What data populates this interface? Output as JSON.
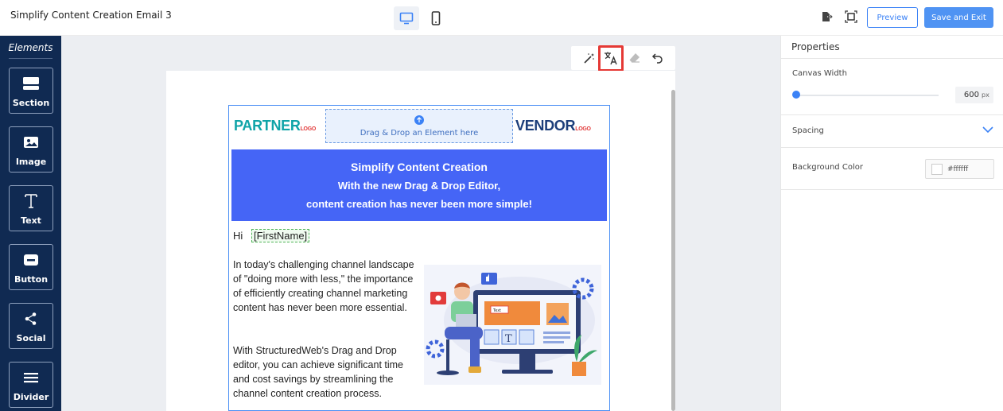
{
  "header": {
    "title": "Simplify Content Creation Email 3",
    "preview_label": "Preview",
    "save_label": "Save and Exit",
    "icons": [
      "desktop-icon",
      "mobile-icon",
      "export-icon",
      "fullscreen-icon"
    ]
  },
  "sidebar": {
    "heading": "Elements",
    "items": [
      {
        "label": "Section",
        "icon": "section-icon"
      },
      {
        "label": "Image",
        "icon": "image-icon"
      },
      {
        "label": "Text",
        "icon": "text-icon"
      },
      {
        "label": "Button",
        "icon": "button-icon"
      },
      {
        "label": "Social",
        "icon": "share-icon"
      },
      {
        "label": "Divider",
        "icon": "divider-icon"
      }
    ]
  },
  "edit_toolbar": {
    "icons": [
      "magic-wand-icon",
      "translate-icon",
      "eraser-icon",
      "undo-icon"
    ],
    "highlighted": "translate-icon",
    "highlight_color": "#e53935"
  },
  "email": {
    "partner_logo": {
      "main": "PARTNER",
      "suffix": "LOGO"
    },
    "vendor_logo": {
      "main": "VENDOR",
      "suffix": "LOGO"
    },
    "dropzone_text": "Drag & Drop an Element here",
    "hero": {
      "title": "Simplify Content Creation",
      "line2": "With the new Drag & Drop Editor,",
      "line3": "content creation has never been more simple!",
      "bg_color": "#4565f6"
    },
    "greeting": "Hi",
    "merge_tag": "[FirstName]",
    "paragraph1": "In today's challenging channel landscape of \"doing more with less,\" the importance of efficiently creating channel marketing content has never been more essential.",
    "paragraph2": "With StructuredWeb's Drag and Drop editor, you can achieve significant time and cost savings by streamlining the channel content creation process.",
    "illustration": {
      "label": "Text",
      "glyph": "T"
    }
  },
  "properties": {
    "title": "Properties",
    "canvas_width_label": "Canvas Width",
    "canvas_width_value": "600",
    "canvas_width_unit": "px",
    "spacing_label": "Spacing",
    "bg_color_label": "Background Color",
    "bg_color_value": "#ffffff"
  },
  "colors": {
    "sidebar_bg": "#102a52",
    "accent": "#3b82f6",
    "save_button": "#4f93f3"
  }
}
